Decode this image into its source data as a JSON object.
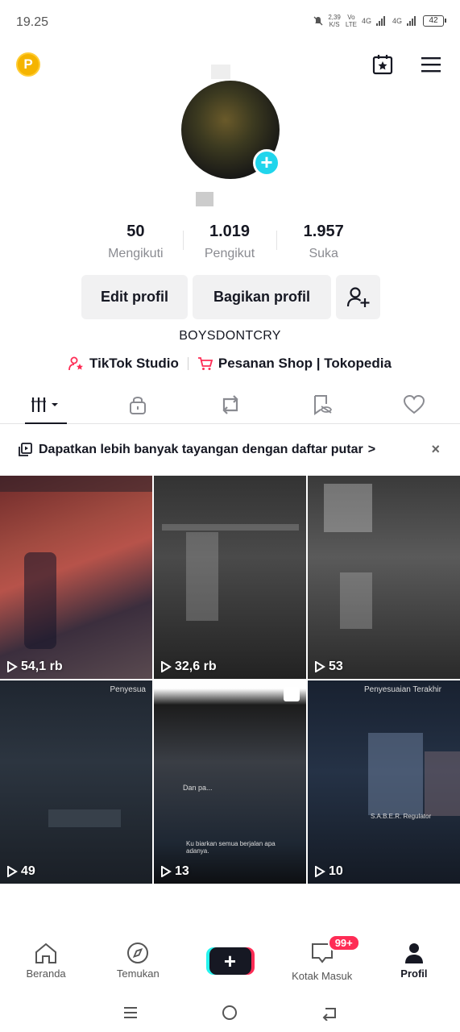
{
  "status_bar": {
    "time": "19.25",
    "speed_value": "2,39",
    "speed_unit": "K/S",
    "volte_top": "Vo",
    "volte_bottom": "LTE",
    "net1": "4G",
    "net2": "4G",
    "battery": "42"
  },
  "profile": {
    "following_count": "50",
    "following_label": "Mengikuti",
    "followers_count": "1.019",
    "followers_label": "Pengikut",
    "likes_count": "1.957",
    "likes_label": "Suka",
    "edit_label": "Edit profil",
    "share_label": "Bagikan profil",
    "username": "BOYSDONTCRY"
  },
  "links": {
    "studio": "TikTok Studio",
    "shop": "Pesanan Shop | Tokopedia"
  },
  "banner": {
    "text": "Dapatkan lebih banyak tayangan dengan daftar putar",
    "chevron": ">",
    "close": "×"
  },
  "videos": [
    {
      "views": "54,1 rb"
    },
    {
      "views": "32,6 rb"
    },
    {
      "views": "53"
    },
    {
      "views": "49"
    },
    {
      "views": "13"
    },
    {
      "views": "10"
    }
  ],
  "video_overlays": {
    "v4_top": "Penyesua",
    "v5_sub1": "Dan pa...",
    "v5_sub2": "Ku biarkan semua berjalan apa adanya.",
    "v6_top": "Penyesuaian Terakhir",
    "v6_card": "S.A.B.E.R. Regulator"
  },
  "bottom_nav": {
    "home": "Beranda",
    "discover": "Temukan",
    "create": "+",
    "inbox": "Kotak Masuk",
    "inbox_badge": "99+",
    "profile": "Profil"
  },
  "colors": {
    "accent_red": "#fe2c55",
    "accent_cyan": "#25f4ee",
    "avatar_add": "#20d5ec",
    "coin": "#f5b400"
  }
}
